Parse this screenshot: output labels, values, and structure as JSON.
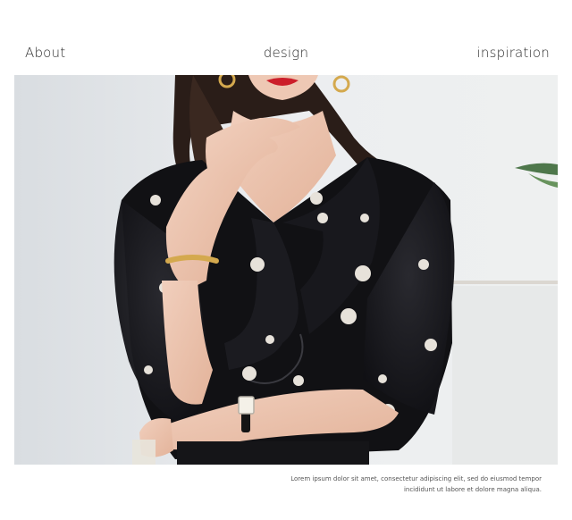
{
  "header": {
    "left": "About",
    "center": "design",
    "right": "inspiration"
  },
  "photo": {
    "subject": "model-in-black-polka-dot-ruffle-blouse",
    "colors": {
      "background": "#e8eaec",
      "blouse": "#111114",
      "dots": "#e7e2da",
      "skin": "#ecc6b1",
      "hair": "#2a1d18",
      "lips": "#cc1e2a",
      "gold": "#d4a94e"
    }
  },
  "caption": {
    "line1": "Lorem ipsum dolor sit amet, consectetur adipiscing elit, sed do eiusmod tempor",
    "line2": "incididunt ut labore et dolore magna aliqua."
  }
}
